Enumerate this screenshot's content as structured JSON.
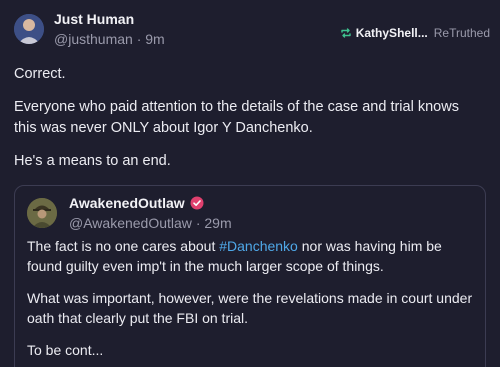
{
  "post": {
    "author": {
      "display_name": "Just Human",
      "handle": "@justhuman",
      "separator": "·",
      "time": "9m"
    },
    "retruth": {
      "icon": "retruth-icon",
      "user": "KathyShell...",
      "label": "ReTruthed"
    },
    "paragraphs": [
      "Correct.",
      "Everyone who paid attention to the details of the case and trial knows this was never ONLY about Igor Y Danchenko.",
      "He's a means to an end."
    ]
  },
  "quote": {
    "author": {
      "display_name": "AwakenedOutlaw",
      "verified_icon": "verified-badge-icon",
      "handle": "@AwakenedOutlaw",
      "separator": "·",
      "time": "29m"
    },
    "paragraph1": {
      "before": "The fact is no one cares about ",
      "hashtag": "#Danchenko",
      "after": " nor was having him be found guilty even imp't in the much larger scope of things."
    },
    "paragraphs": [
      "What was important, however, were the revelations made in court under oath that clearly put the FBI on trial.",
      "To be cont..."
    ]
  },
  "colors": {
    "background": "#1e1e2e",
    "hashtag": "#4fa8e8",
    "verified": "#e0406e",
    "retruth": "#3ec28f"
  }
}
